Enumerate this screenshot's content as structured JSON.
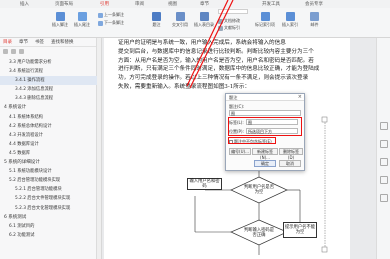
{
  "ribbon": {
    "tabs": [
      "插入",
      "页面布局",
      "引用",
      "审阅",
      "视图",
      "章节",
      "开发工具",
      "会员专享"
    ],
    "items": [
      {
        "label": "插入脚注",
        "icon": "footnote-icon"
      },
      {
        "label": "插入尾注",
        "icon": "endnote-icon"
      },
      {
        "label": "上一条脚注",
        "icon": "prev-footnote-icon"
      },
      {
        "label": "下一条脚注",
        "icon": "next-footnote-icon"
      },
      {
        "label": "题注",
        "icon": "caption-icon"
      },
      {
        "label": "交叉引用",
        "icon": "cross-reference-icon"
      },
      {
        "label": "插入表目录",
        "icon": "table-of-figures-icon"
      },
      {
        "label": "标记索引项",
        "icon": "mark-index-icon"
      },
      {
        "label": "插入索引",
        "icon": "insert-index-icon"
      },
      {
        "label": "邮件",
        "icon": "mail-icon"
      }
    ],
    "small": [
      "文档修改",
      "文献标引"
    ]
  },
  "sidebar": {
    "tabs": [
      "目录",
      "章节",
      "书签",
      "查找和替换"
    ],
    "items": [
      {
        "label": "3.3 用户功能需求分析",
        "level": 2
      },
      {
        "label": "3.4 系统运行流程",
        "level": 2
      },
      {
        "label": "3.4.1 操作流程",
        "level": 3,
        "selected": true
      },
      {
        "label": "3.4.2 添加信息流程",
        "level": 3
      },
      {
        "label": "3.4.3 删除信息流程",
        "level": 3
      },
      {
        "label": "4 系统设计",
        "level": 1
      },
      {
        "label": "4.1 系统体系结构",
        "level": 2
      },
      {
        "label": "4.2 系统总体结构设计",
        "level": 2
      },
      {
        "label": "4.3 开发流程设计",
        "level": 2
      },
      {
        "label": "4.4 数据库设计",
        "level": 2
      },
      {
        "label": "4.5 数据库",
        "level": 2
      },
      {
        "label": "5 系统的详细设计",
        "level": 1
      },
      {
        "label": "5.1 系统功能模块设计",
        "level": 2
      },
      {
        "label": "5.2 后台管理功能模块实现",
        "level": 2
      },
      {
        "label": "5.2.1 后台管理功能模块",
        "level": 3
      },
      {
        "label": "5.2.2 后台文件管理模块实现",
        "level": 3
      },
      {
        "label": "5.2.3 后台文化管理模块实现",
        "level": 3
      },
      {
        "label": "6 系统测试",
        "level": 1
      },
      {
        "label": "6.1 测试目的",
        "level": 2
      },
      {
        "label": "6.2 功能测试",
        "level": 2
      }
    ]
  },
  "document": {
    "paragraph": [
      "证用户的证明是与系统一致，用户输入完成后，系统会将输入的信息",
      "提交到后台，与数据库中的信息记录进行比较判断。判断比较内容主要分为三个",
      "方面：从用户名是否为空，输入的用户名是否为空，用户名和密码是否匹配。若",
      "进行判断，只有满足三个条件同时满足，数据库中的信息比较正确，才能为登陆成",
      "功，方可完成登录的操作。若以上三种情况有一条不满足，则会提示该次登录",
      "失败，需要重新输入。系统登录流程图如图3-1所示："
    ],
    "flowchart": {
      "box_input": "输入用户名和密码",
      "diamond_user": "判断用户名是否为空",
      "diamond_check": "判断输入密码是否正确",
      "box_error": "提示用户名不能为空"
    }
  },
  "dialog": {
    "title": "题注",
    "caption_label": "题注(C):",
    "caption_value": "图",
    "label_label": "标签(L):",
    "label_value": "图",
    "position_label": "位置(P):",
    "position_value": "所选项目下方",
    "exclude_label": "题注中不包含标签(E)",
    "buttons": {
      "numbering": "编号(U)...",
      "new_label": "新建标签(N)...",
      "delete_label": "删除标签(D)",
      "ok": "确定",
      "cancel": "取消"
    }
  },
  "colors": {
    "highlight": "#e11111",
    "accent": "#e0362f",
    "selected_row": "#dfe7f3"
  }
}
